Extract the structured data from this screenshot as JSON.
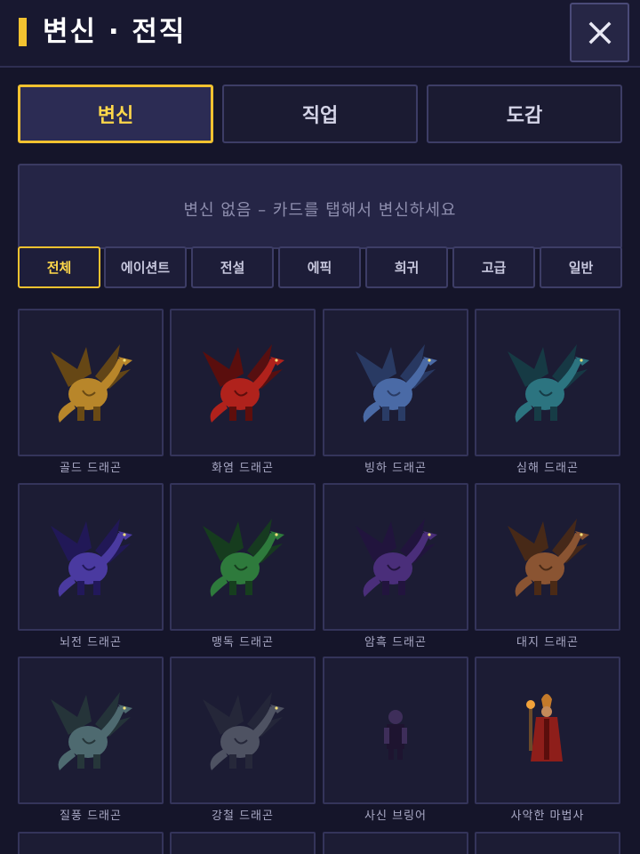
{
  "header": {
    "title": "변신 · 전직"
  },
  "main_tabs": [
    {
      "label": "변신",
      "active": true
    },
    {
      "label": "직업",
      "active": false
    },
    {
      "label": "도감",
      "active": false
    }
  ],
  "status": {
    "text": "변신 없음 – 카드를 탭해서 변신하세요"
  },
  "filters": [
    {
      "label": "전체",
      "active": true
    },
    {
      "label": "에이션트",
      "active": false
    },
    {
      "label": "전설",
      "active": false
    },
    {
      "label": "에픽",
      "active": false
    },
    {
      "label": "희귀",
      "active": false
    },
    {
      "label": "고급",
      "active": false
    },
    {
      "label": "일반",
      "active": false
    }
  ],
  "cards": [
    {
      "name": "골드 드래곤",
      "icon": "gold-dragon-icon",
      "color": "#b8862a",
      "dark": "#6a4a14"
    },
    {
      "name": "화염 드래곤",
      "icon": "flame-dragon-icon",
      "color": "#b0221c",
      "dark": "#5e0e0c"
    },
    {
      "name": "빙하 드래곤",
      "icon": "glacier-dragon-icon",
      "color": "#4a6aa6",
      "dark": "#2a3c66"
    },
    {
      "name": "심해 드래곤",
      "icon": "deepsea-dragon-icon",
      "color": "#2c7480",
      "dark": "#163c46"
    },
    {
      "name": "뇌전 드래곤",
      "icon": "thunder-dragon-icon",
      "color": "#4a3aa0",
      "dark": "#22185a"
    },
    {
      "name": "맹독 드래곤",
      "icon": "venom-dragon-icon",
      "color": "#2e7a3c",
      "dark": "#163e1e"
    },
    {
      "name": "암흑 드래곤",
      "icon": "darkness-dragon-icon",
      "color": "#4a2e7a",
      "dark": "#22143e"
    },
    {
      "name": "대지 드래곤",
      "icon": "earth-dragon-icon",
      "color": "#8a5432",
      "dark": "#4a2a16"
    },
    {
      "name": "질풍 드래곤",
      "icon": "gale-dragon-icon",
      "color": "#4e6a70",
      "dark": "#26363a"
    },
    {
      "name": "강철 드래곤",
      "icon": "steel-dragon-icon",
      "color": "#4e5262",
      "dark": "#26283a"
    },
    {
      "name": "사신 브링어",
      "icon": "reaper-bringer-icon",
      "color": "#3e2e5a",
      "dark": "#1e1430"
    },
    {
      "name": "사악한 마법사",
      "icon": "wicked-wizard-icon",
      "color": "#8e1e1a",
      "dark": "#c47a2a"
    }
  ]
}
